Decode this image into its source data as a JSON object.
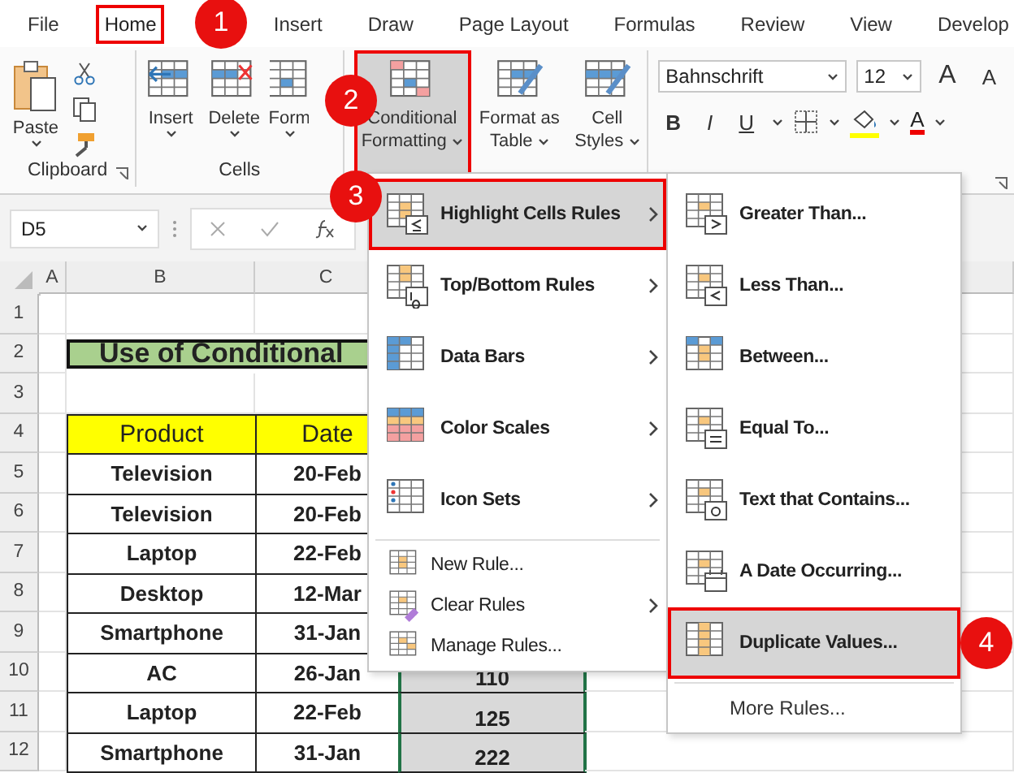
{
  "tabs": [
    {
      "label": "File",
      "selected": false
    },
    {
      "label": "Home",
      "selected": true
    },
    {
      "label": "Insert",
      "selected": false
    },
    {
      "label": "Draw",
      "selected": false
    },
    {
      "label": "Page Layout",
      "selected": false
    },
    {
      "label": "Formulas",
      "selected": false
    },
    {
      "label": "Review",
      "selected": false
    },
    {
      "label": "View",
      "selected": false
    },
    {
      "label": "Develop",
      "selected": false
    }
  ],
  "callouts": [
    "1",
    "2",
    "3",
    "4"
  ],
  "ribbon": {
    "clipboard": {
      "paste": "Paste",
      "label": "Clipboard"
    },
    "cells": {
      "buttons": [
        "Insert",
        "Delete",
        "Form"
      ],
      "label": "Cells"
    },
    "styles": [
      {
        "label": "Conditional Formatting",
        "selected": true
      },
      {
        "label": "Format as Table",
        "selected": false
      },
      {
        "label": "Cell Styles",
        "selected": false
      }
    ],
    "font": {
      "name": "Bahnschrift",
      "size": "12",
      "grow": "A",
      "shrink": "A",
      "styles": [
        "B",
        "I",
        "U"
      ],
      "color_button": "A"
    }
  },
  "formula_bar": {
    "name_box": "D5"
  },
  "sheet": {
    "columns": [
      "A",
      "B",
      "C"
    ],
    "rows": [
      "1",
      "2",
      "3",
      "4",
      "5",
      "6",
      "7",
      "8",
      "9",
      "10",
      "11",
      "12"
    ],
    "title": "Use of Conditional",
    "headers": [
      "Product",
      "Date"
    ],
    "data": [
      [
        "Television",
        "20-Feb"
      ],
      [
        "Television",
        "20-Feb"
      ],
      [
        "Laptop",
        "22-Feb"
      ],
      [
        "Desktop",
        "12-Mar"
      ],
      [
        "Smartphone",
        "31-Jan"
      ],
      [
        "AC",
        "26-Jan",
        "110"
      ],
      [
        "Laptop",
        "22-Feb",
        "125"
      ],
      [
        "Smartphone",
        "31-Jan",
        "222"
      ]
    ]
  },
  "menu": {
    "items": [
      {
        "label": "Highlight Cells Rules",
        "kind": "submenu",
        "selected": true
      },
      {
        "label": "Top/Bottom Rules",
        "kind": "submenu",
        "selected": false
      },
      {
        "label": "Data Bars",
        "kind": "submenu",
        "selected": false
      },
      {
        "label": "Color Scales",
        "kind": "submenu",
        "selected": false
      },
      {
        "label": "Icon Sets",
        "kind": "submenu",
        "selected": false
      },
      {
        "label": "New Rule...",
        "kind": "command",
        "selected": false
      },
      {
        "label": "Clear Rules",
        "kind": "submenu_small",
        "selected": false
      },
      {
        "label": "Manage Rules...",
        "kind": "command",
        "selected": false
      }
    ]
  },
  "submenu": {
    "items": [
      {
        "label": "Greater Than...",
        "selected": false
      },
      {
        "label": "Less Than...",
        "selected": false
      },
      {
        "label": "Between...",
        "selected": false
      },
      {
        "label": "Equal To...",
        "selected": false
      },
      {
        "label": "Text that Contains...",
        "selected": false
      },
      {
        "label": "A Date Occurring...",
        "selected": false
      },
      {
        "label": "Duplicate Values...",
        "selected": true
      }
    ],
    "more": "More Rules..."
  }
}
